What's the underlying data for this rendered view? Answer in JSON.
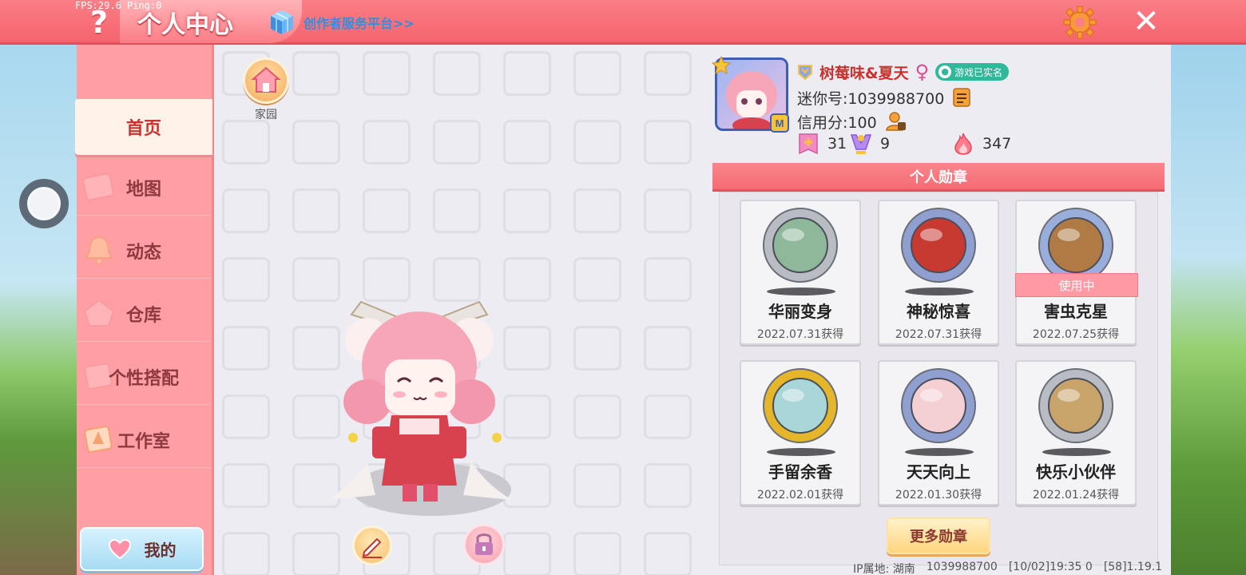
{
  "debug": {
    "fps_text": "FPS:29.6  Ping:0"
  },
  "header": {
    "title": "个人中心",
    "creator_link": "创作者服务平台>>",
    "help_glyph": "?",
    "close_glyph": "✕"
  },
  "sidebar": {
    "items": [
      {
        "label": "首页",
        "active": true
      },
      {
        "label": "地图",
        "active": false
      },
      {
        "label": "动态",
        "active": false
      },
      {
        "label": "仓库",
        "active": false
      },
      {
        "label": "个性搭配",
        "active": false
      },
      {
        "label": "工作室",
        "active": false
      }
    ],
    "mine_label": "我的"
  },
  "home": {
    "label": "家园"
  },
  "profile": {
    "username": "树莓味&夏天",
    "gender_symbol": "♀",
    "verified_label": "游戏已实名",
    "mini_id": "迷你号:1039988700",
    "credit": "信用分:100",
    "stats": [
      {
        "icon": "plus-card-icon",
        "value": "31"
      },
      {
        "icon": "trophy-person-icon",
        "value": "9"
      },
      {
        "icon": "flame-icon",
        "value": "347"
      }
    ]
  },
  "medals": {
    "header": "个人勋章",
    "in_use_label": "使用中",
    "items": [
      {
        "name": "华丽变身",
        "date": "2022.07.31获得",
        "rim": "#b9bcc2",
        "face": "#8fb79a",
        "in_use": false
      },
      {
        "name": "神秘惊喜",
        "date": "2022.07.31获得",
        "rim": "#8f9fd0",
        "face": "#c63a32",
        "in_use": false
      },
      {
        "name": "害虫克星",
        "date": "2022.07.25获得",
        "rim": "#9aaedc",
        "face": "#b07a44",
        "in_use": true
      },
      {
        "name": "手留余香",
        "date": "2022.02.01获得",
        "rim": "#e6b62a",
        "face": "#a9d6d9",
        "in_use": false
      },
      {
        "name": "天天向上",
        "date": "2022.01.30获得",
        "rim": "#8f9fd0",
        "face": "#f4d0d4",
        "in_use": false
      },
      {
        "name": "快乐小伙伴",
        "date": "2022.01.24获得",
        "rim": "#b9bcc2",
        "face": "#c8a46a",
        "in_use": false
      }
    ],
    "more_label": "更多勋章"
  },
  "footer": {
    "ip_location": "IP属地: 湖南",
    "user_id": "1039988700",
    "timestamp": "[10/02]19:35 0",
    "version": "[58]1.19.1"
  },
  "colors": {
    "accent": "#f5646e",
    "sidebar": "#ff9ea3",
    "active_tab": "#fff3e9",
    "panel": "#ececf2"
  }
}
